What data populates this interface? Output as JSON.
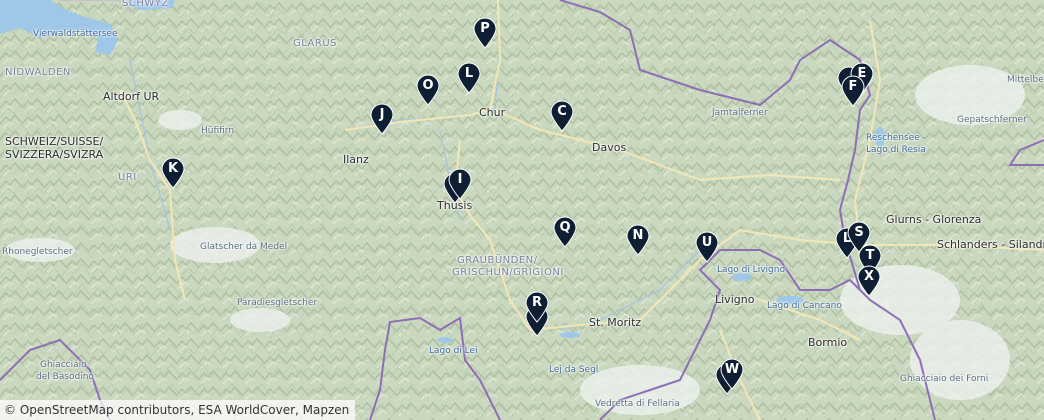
{
  "labels": {
    "schwyz": "SCHWYZ",
    "vierwald": "Vierwaldstättersee",
    "glarus": "GLARUS",
    "nidwalden": "NIDWALDEN",
    "altdorf": "Altdorf UR",
    "huefifirn": "Hüfifirn",
    "schweiz1": "SCHWEIZ/SUISSE/",
    "schweiz2": "SVIZZERA/SVIZRA",
    "uri": "URI",
    "ilanz": "Ilanz",
    "chur": "Chur",
    "davos": "Davos",
    "thusis": "Thusis",
    "gr1": "GRAUBÜNDEN/",
    "gr2": "GRISCHUN/GRIGIONI",
    "glatscher": "Glatscher da Medel",
    "rhone": "Rhonegletscher",
    "paradies": "Paradiesgletscher",
    "ghiacciaio1": "Ghiacciaio",
    "ghiacciaio2": "del Basodino",
    "lagodilei": "Lago di Lei",
    "stmoritz": "St. Moritz",
    "ledasegl": "Lej da Segl",
    "vedretta": "Vedretta di Fellaria",
    "livigno": "Livigno",
    "lagolivigno": "Lago di Livigno",
    "cancano": "Lago di Cancano",
    "bormio": "Bormio",
    "forni": "Ghiacciaio dei Forni",
    "glurns": "Glurns - Glorenza",
    "schlanders": "Schlanders - Silandro",
    "reschensee1": "Reschensee -",
    "reschensee2": "Lago di Resia",
    "gepatsch": "Gepatschferner",
    "mittelberg": "Mittelber",
    "hamel": "Jamtalferner"
  },
  "markers": [
    "P",
    "L",
    "O",
    "J",
    "C",
    "E",
    "F",
    "K",
    "I",
    "Q",
    "N",
    "U",
    "S",
    "L",
    "T",
    "X",
    "R",
    "W"
  ],
  "attribution": "© OpenStreetMap contributors, ESA WorldCover, Mapzen",
  "colors": {
    "marker": "#0e1f33",
    "water": "#9ec7e8",
    "border": "#8e6fb5",
    "road": "#f1e6c0"
  }
}
